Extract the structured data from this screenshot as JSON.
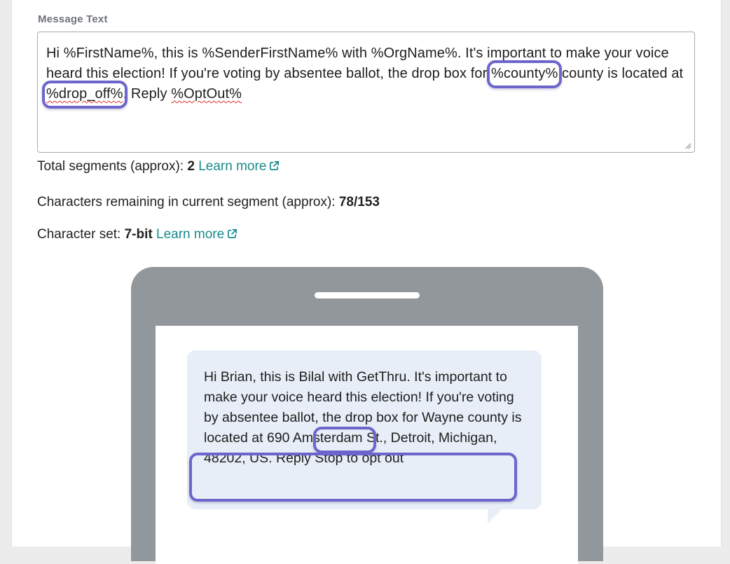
{
  "form": {
    "label": "Message Text",
    "message_parts": {
      "p1": "Hi %FirstName%, this is %SenderFirstName% with %OrgName%. It's important to make your voice heard this election! If you're voting by absentee ballot, the drop box for ",
      "county_token": "%county%",
      "p2": " county is located at ",
      "drop_off_token": "%drop_off%",
      "p3": ". Reply ",
      "optout_token": "%OptOut%"
    }
  },
  "stats": {
    "segments_label": "Total segments (approx):",
    "segments_value": "2",
    "segments_link": "Learn more",
    "remaining_label": "Characters remaining in current segment (approx):",
    "remaining_value": "78/153",
    "charset_label": "Character set:",
    "charset_value": "7-bit",
    "charset_link": "Learn more"
  },
  "preview": {
    "p1": "Hi Brian, this is Bilal with GetThru. It's important to make your voice heard this election! If you're voting by absentee ballot, the drop box for ",
    "county": "Wayne",
    "p2": " county is located at ",
    "address": "690 Amsterdam St., Detroit, Michigan, 48202, US",
    "p3": ". Reply Stop to opt out"
  },
  "colors": {
    "highlight": "#6c66cc",
    "link": "#1a8a8a",
    "phone": "#92979c",
    "bubble": "#e8eef7"
  }
}
